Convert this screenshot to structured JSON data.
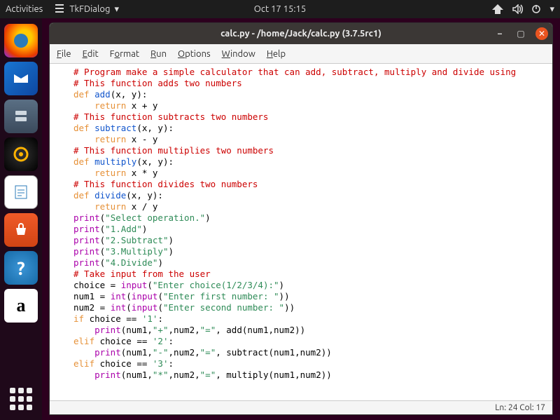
{
  "topbar": {
    "activities": "Activities",
    "app_name": "TkFDialog",
    "datetime": "Oct 17  15:15"
  },
  "window": {
    "title": "calc.py - /home/Jack/calc.py (3.7.5rc1)",
    "status": "Ln: 24  Col: 17"
  },
  "menu": {
    "file": "File",
    "edit": "Edit",
    "format": "Format",
    "run": "Run",
    "options": "Options",
    "window": "Window",
    "help": "Help"
  },
  "code": {
    "l01": "# Program make a simple calculator that can add, subtract, multiply and divide using",
    "l02": "# This function adds two numbers",
    "l03a": "def",
    "l03b": " add",
    "l03c": "(x, y):",
    "l04a": "return",
    "l04b": " x + y",
    "l05": "# This function subtracts two numbers",
    "l06a": "def",
    "l06b": " subtract",
    "l06c": "(x, y):",
    "l07a": "return",
    "l07b": " x - y",
    "l08": "# This function multiplies two numbers",
    "l09a": "def",
    "l09b": " multiply",
    "l09c": "(x, y):",
    "l10a": "return",
    "l10b": " x * y",
    "l11": "# This function divides two numbers",
    "l12a": "def",
    "l12b": " divide",
    "l12c": "(x, y):",
    "l13a": "return",
    "l13b": " x / y",
    "l14a": "print",
    "l14b": "(",
    "l14c": "\"Select operation.\"",
    "l14d": ")",
    "l15a": "print",
    "l15b": "(",
    "l15c": "\"1.Add\"",
    "l15d": ")",
    "l16a": "print",
    "l16b": "(",
    "l16c": "\"2.Subtract\"",
    "l16d": ")",
    "l17a": "print",
    "l17b": "(",
    "l17c": "\"3.Multiply\"",
    "l17d": ")",
    "l18a": "print",
    "l18b": "(",
    "l18c": "\"4.Divide\"",
    "l18d": ")",
    "l19": "# Take input from the user",
    "l20a": "choice = ",
    "l20b": "input",
    "l20c": "(",
    "l20d": "\"Enter choice(1/2/3/4):\"",
    "l20e": ")",
    "l21a": "num1 = ",
    "l21b": "int",
    "l21c": "(",
    "l21d": "input",
    "l21e": "(",
    "l21f": "\"Enter first number: \"",
    "l21g": "))",
    "l22a": "num2 = ",
    "l22b": "int",
    "l22c": "(",
    "l22d": "input",
    "l22e": "(",
    "l22f": "\"Enter second number: \"",
    "l22g": "))",
    "l23a": "if",
    "l23b": " choice == ",
    "l23c": "'1'",
    "l23d": ":",
    "l24a": "print",
    "l24b": "(num1,",
    "l24c": "\"+\"",
    "l24d": ",num2,",
    "l24e": "\"=\"",
    "l24f": ", add(num1,num2))",
    "l25a": "elif",
    "l25b": " choice == ",
    "l25c": "'2'",
    "l25d": ":",
    "l26a": "print",
    "l26b": "(num1,",
    "l26c": "\"-\"",
    "l26d": ",num2,",
    "l26e": "\"=\"",
    "l26f": ", subtract(num1,num2))",
    "l27a": "elif",
    "l27b": " choice == ",
    "l27c": "'3'",
    "l27d": ":",
    "l28a": "print",
    "l28b": "(num1,",
    "l28c": "\"*\"",
    "l28d": ",num2,",
    "l28e": "\"=\"",
    "l28f": ", multiply(num1,num2))",
    "indent1": "    ",
    "indent2": "    "
  }
}
